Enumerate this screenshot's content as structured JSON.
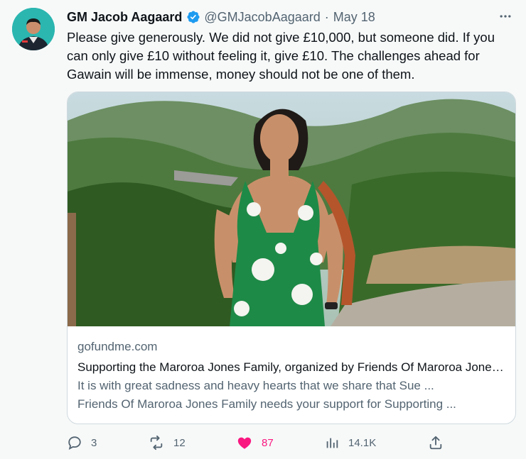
{
  "tweet": {
    "author_name": "GM Jacob Aagaard",
    "handle": "@GMJacobAagaard",
    "separator": "·",
    "date": "May 18",
    "text": "Please give generously. We did not give £10,000, but someone did. If you can only give £10 without feeling it, give £10. The challenges ahead for Gawain will be immense, money should not be one of them."
  },
  "card": {
    "domain": "gofundme.com",
    "title": "Supporting the Maroroa Jones Family, organized by Friends Of Maroroa Jones Family",
    "description_line1": "It is with great sadness and heavy hearts that we share that Sue ...",
    "description_line2": "Friends Of Maroroa Jones Family needs your support for Supporting ..."
  },
  "actions": {
    "replies": "3",
    "retweets": "12",
    "likes": "87",
    "views": "14.1K"
  },
  "icons": {
    "verified": "verified-badge-icon",
    "more": "more-icon",
    "reply": "reply-icon",
    "retweet": "retweet-icon",
    "like": "heart-icon",
    "views": "views-icon",
    "share": "share-icon"
  },
  "colors": {
    "verified": "#1d9bf0",
    "like": "#f91880",
    "muted": "#536471",
    "text": "#0f1419",
    "avatar_bg": "#2bb6b0"
  }
}
